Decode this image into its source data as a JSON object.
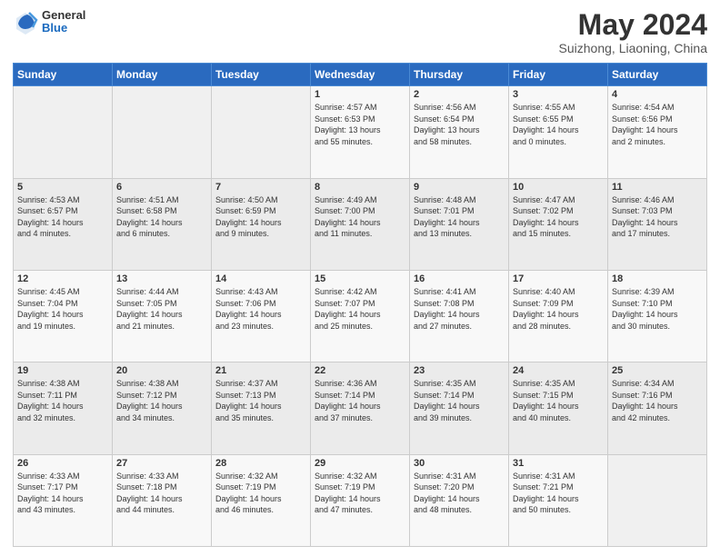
{
  "header": {
    "logo_general": "General",
    "logo_blue": "Blue",
    "month_title": "May 2024",
    "subtitle": "Suizhong, Liaoning, China"
  },
  "weekdays": [
    "Sunday",
    "Monday",
    "Tuesday",
    "Wednesday",
    "Thursday",
    "Friday",
    "Saturday"
  ],
  "weeks": [
    [
      {
        "day": "",
        "info": ""
      },
      {
        "day": "",
        "info": ""
      },
      {
        "day": "",
        "info": ""
      },
      {
        "day": "1",
        "info": "Sunrise: 4:57 AM\nSunset: 6:53 PM\nDaylight: 13 hours\nand 55 minutes."
      },
      {
        "day": "2",
        "info": "Sunrise: 4:56 AM\nSunset: 6:54 PM\nDaylight: 13 hours\nand 58 minutes."
      },
      {
        "day": "3",
        "info": "Sunrise: 4:55 AM\nSunset: 6:55 PM\nDaylight: 14 hours\nand 0 minutes."
      },
      {
        "day": "4",
        "info": "Sunrise: 4:54 AM\nSunset: 6:56 PM\nDaylight: 14 hours\nand 2 minutes."
      }
    ],
    [
      {
        "day": "5",
        "info": "Sunrise: 4:53 AM\nSunset: 6:57 PM\nDaylight: 14 hours\nand 4 minutes."
      },
      {
        "day": "6",
        "info": "Sunrise: 4:51 AM\nSunset: 6:58 PM\nDaylight: 14 hours\nand 6 minutes."
      },
      {
        "day": "7",
        "info": "Sunrise: 4:50 AM\nSunset: 6:59 PM\nDaylight: 14 hours\nand 9 minutes."
      },
      {
        "day": "8",
        "info": "Sunrise: 4:49 AM\nSunset: 7:00 PM\nDaylight: 14 hours\nand 11 minutes."
      },
      {
        "day": "9",
        "info": "Sunrise: 4:48 AM\nSunset: 7:01 PM\nDaylight: 14 hours\nand 13 minutes."
      },
      {
        "day": "10",
        "info": "Sunrise: 4:47 AM\nSunset: 7:02 PM\nDaylight: 14 hours\nand 15 minutes."
      },
      {
        "day": "11",
        "info": "Sunrise: 4:46 AM\nSunset: 7:03 PM\nDaylight: 14 hours\nand 17 minutes."
      }
    ],
    [
      {
        "day": "12",
        "info": "Sunrise: 4:45 AM\nSunset: 7:04 PM\nDaylight: 14 hours\nand 19 minutes."
      },
      {
        "day": "13",
        "info": "Sunrise: 4:44 AM\nSunset: 7:05 PM\nDaylight: 14 hours\nand 21 minutes."
      },
      {
        "day": "14",
        "info": "Sunrise: 4:43 AM\nSunset: 7:06 PM\nDaylight: 14 hours\nand 23 minutes."
      },
      {
        "day": "15",
        "info": "Sunrise: 4:42 AM\nSunset: 7:07 PM\nDaylight: 14 hours\nand 25 minutes."
      },
      {
        "day": "16",
        "info": "Sunrise: 4:41 AM\nSunset: 7:08 PM\nDaylight: 14 hours\nand 27 minutes."
      },
      {
        "day": "17",
        "info": "Sunrise: 4:40 AM\nSunset: 7:09 PM\nDaylight: 14 hours\nand 28 minutes."
      },
      {
        "day": "18",
        "info": "Sunrise: 4:39 AM\nSunset: 7:10 PM\nDaylight: 14 hours\nand 30 minutes."
      }
    ],
    [
      {
        "day": "19",
        "info": "Sunrise: 4:38 AM\nSunset: 7:11 PM\nDaylight: 14 hours\nand 32 minutes."
      },
      {
        "day": "20",
        "info": "Sunrise: 4:38 AM\nSunset: 7:12 PM\nDaylight: 14 hours\nand 34 minutes."
      },
      {
        "day": "21",
        "info": "Sunrise: 4:37 AM\nSunset: 7:13 PM\nDaylight: 14 hours\nand 35 minutes."
      },
      {
        "day": "22",
        "info": "Sunrise: 4:36 AM\nSunset: 7:14 PM\nDaylight: 14 hours\nand 37 minutes."
      },
      {
        "day": "23",
        "info": "Sunrise: 4:35 AM\nSunset: 7:14 PM\nDaylight: 14 hours\nand 39 minutes."
      },
      {
        "day": "24",
        "info": "Sunrise: 4:35 AM\nSunset: 7:15 PM\nDaylight: 14 hours\nand 40 minutes."
      },
      {
        "day": "25",
        "info": "Sunrise: 4:34 AM\nSunset: 7:16 PM\nDaylight: 14 hours\nand 42 minutes."
      }
    ],
    [
      {
        "day": "26",
        "info": "Sunrise: 4:33 AM\nSunset: 7:17 PM\nDaylight: 14 hours\nand 43 minutes."
      },
      {
        "day": "27",
        "info": "Sunrise: 4:33 AM\nSunset: 7:18 PM\nDaylight: 14 hours\nand 44 minutes."
      },
      {
        "day": "28",
        "info": "Sunrise: 4:32 AM\nSunset: 7:19 PM\nDaylight: 14 hours\nand 46 minutes."
      },
      {
        "day": "29",
        "info": "Sunrise: 4:32 AM\nSunset: 7:19 PM\nDaylight: 14 hours\nand 47 minutes."
      },
      {
        "day": "30",
        "info": "Sunrise: 4:31 AM\nSunset: 7:20 PM\nDaylight: 14 hours\nand 48 minutes."
      },
      {
        "day": "31",
        "info": "Sunrise: 4:31 AM\nSunset: 7:21 PM\nDaylight: 14 hours\nand 50 minutes."
      },
      {
        "day": "",
        "info": ""
      }
    ]
  ]
}
